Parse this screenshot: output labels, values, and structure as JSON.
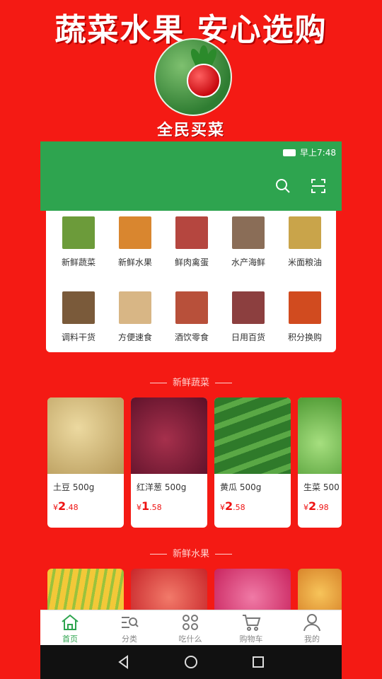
{
  "promo": {
    "headline": "蔬菜水果  安心选购",
    "app_name": "全民买菜"
  },
  "status_bar": {
    "time": "早上7:48"
  },
  "categories": [
    {
      "label": "新鲜蔬菜",
      "color": "#6c9b3a"
    },
    {
      "label": "新鲜水果",
      "color": "#d9862f"
    },
    {
      "label": "鲜肉禽蛋",
      "color": "#b5463f"
    },
    {
      "label": "水产海鲜",
      "color": "#8a6d57"
    },
    {
      "label": "米面粮油",
      "color": "#c9a44a"
    },
    {
      "label": "调料干货",
      "color": "#7a5a3a"
    },
    {
      "label": "方便速食",
      "color": "#d8b685"
    },
    {
      "label": "酒饮零食",
      "color": "#b8503a"
    },
    {
      "label": "日用百货",
      "color": "#8c3f3f"
    },
    {
      "label": "积分换购",
      "color": "#d14b1f"
    }
  ],
  "sections": {
    "vegetables_title": "新鲜蔬菜",
    "fruits_title": "新鲜水果"
  },
  "vegetables": [
    {
      "name": "土豆 500g",
      "currency": "¥",
      "price_int": "2",
      "price_dec": ".48",
      "color": "#d8c184"
    },
    {
      "name": "红洋葱 500g",
      "currency": "¥",
      "price_int": "1",
      "price_dec": ".58",
      "color": "#8a2240"
    },
    {
      "name": "黄瓜 500g",
      "currency": "¥",
      "price_int": "2",
      "price_dec": ".58",
      "color": "#3f8a35"
    },
    {
      "name": "生菜 500",
      "currency": "¥",
      "price_int": "2",
      "price_dec": ".98",
      "color": "#79c453"
    }
  ],
  "fruits": [
    {
      "color": "#f3c838"
    },
    {
      "color": "#e8504a"
    },
    {
      "color": "#e2457e"
    },
    {
      "color": "#f0a73a"
    }
  ],
  "tabs": [
    {
      "label": "首页",
      "icon": "home-icon",
      "active": true
    },
    {
      "label": "分类",
      "icon": "category-icon",
      "active": false
    },
    {
      "label": "吃什么",
      "icon": "grid-icon",
      "active": false
    },
    {
      "label": "购物车",
      "icon": "cart-icon",
      "active": false
    },
    {
      "label": "我的",
      "icon": "user-icon",
      "active": false
    }
  ],
  "colors": {
    "brand_green": "#2ea44f",
    "promo_red": "#f41a14",
    "price_red": "#ee1111"
  }
}
